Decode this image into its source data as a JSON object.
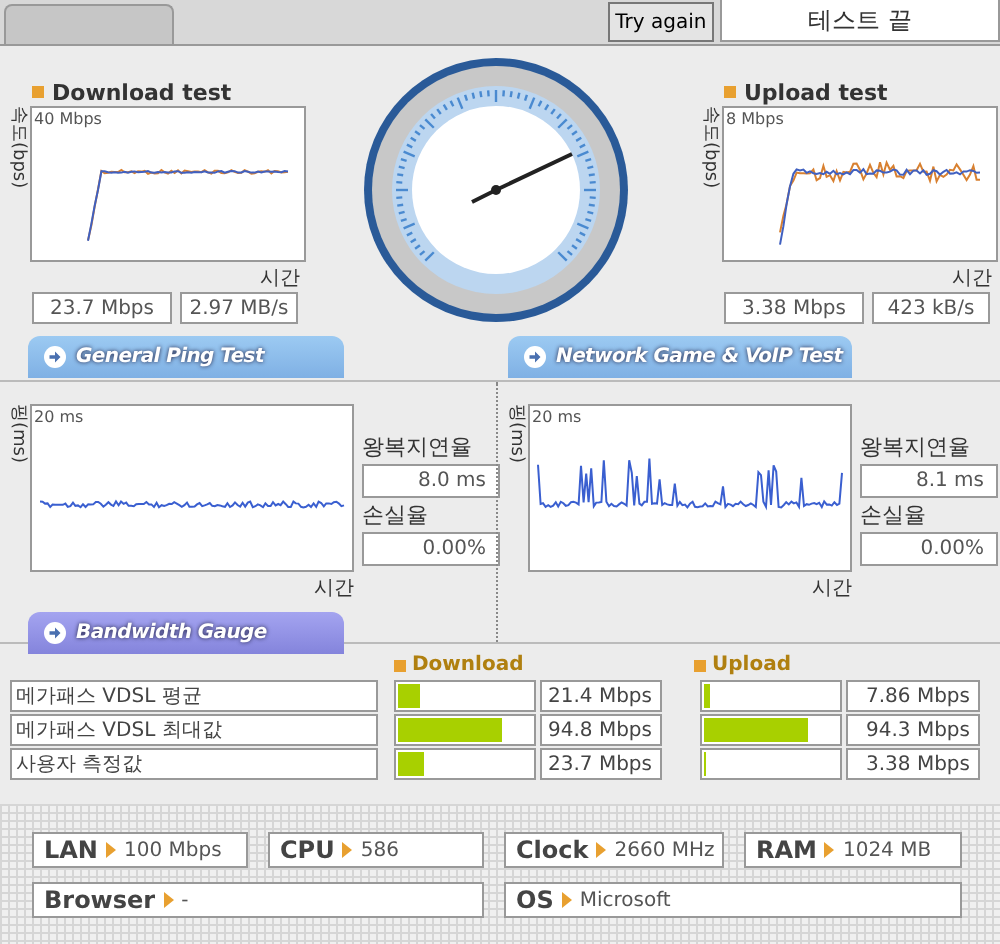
{
  "top_bar": {
    "button": "Try again",
    "status": "테스트 끝"
  },
  "speed_tests": [
    {
      "title": "Download test",
      "y_label": "속도(bps)",
      "scale": "40 Mbps",
      "x_label": "시간",
      "readings": [
        "23.7 Mbps",
        "2.97 MB/s"
      ]
    },
    {
      "title": "Upload test",
      "y_label": "속도(bps)",
      "scale": "8 Mbps",
      "x_label": "시간",
      "readings": [
        "3.38 Mbps",
        "423 kB/s"
      ]
    }
  ],
  "section_buttons": [
    "General Ping Test",
    "Network Game & VoIP Test"
  ],
  "ping_tests": [
    {
      "y_label": "핑(ms)",
      "scale": "20 ms",
      "x_label": "시간",
      "latency_label": "왕복지연율",
      "latency": "8.0 ms",
      "loss_label": "손실율",
      "loss": "0.00%"
    },
    {
      "y_label": "핑(ms)",
      "scale": "20 ms",
      "x_label": "시간",
      "latency_label": "왕복지연율",
      "latency": "8.1 ms",
      "loss_label": "손실율",
      "loss": "0.00%"
    }
  ],
  "bandwidth_button": "Bandwidth Gauge",
  "bandwidth": {
    "headers": [
      "Download",
      "Upload"
    ],
    "rows": [
      {
        "label": "메가패스 VDSL 평균",
        "download": {
          "level": 0.16,
          "value": "21.4 Mbps"
        },
        "upload": {
          "level": 0.04,
          "value": "7.86 Mbps"
        }
      },
      {
        "label": "메가패스 VDSL 최대값",
        "download": {
          "level": 0.78,
          "value": "94.8 Mbps"
        },
        "upload": {
          "level": 0.78,
          "value": "94.3 Mbps"
        }
      },
      {
        "label": "사용자 측정값",
        "download": {
          "level": 0.19,
          "value": "23.7 Mbps"
        },
        "upload": {
          "level": 0.02,
          "value": "3.38 Mbps"
        }
      }
    ]
  },
  "system_info": [
    [
      {
        "label": "LAN",
        "value": "100 Mbps"
      },
      {
        "label": "CPU",
        "value": "586"
      },
      {
        "label": "Clock",
        "value": "2660 MHz"
      },
      {
        "label": "RAM",
        "value": "1024 MB"
      }
    ],
    [
      {
        "label": "Browser",
        "value": "-"
      },
      {
        "label": "OS",
        "value": "Microsoft"
      }
    ]
  ]
}
